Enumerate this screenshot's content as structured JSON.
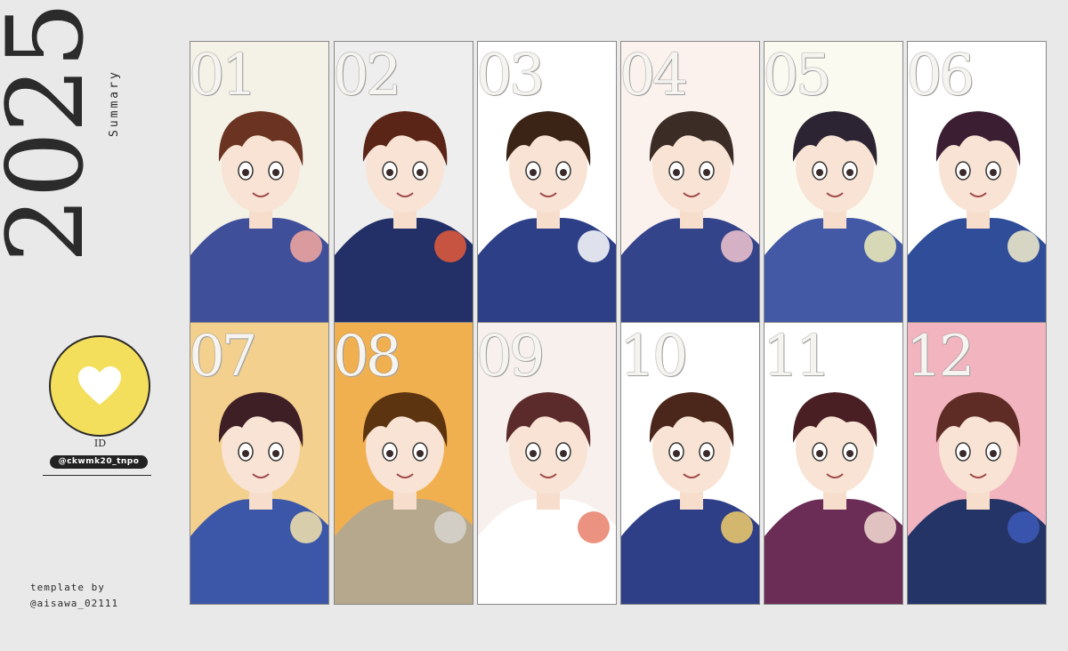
{
  "title": {
    "year": "2025",
    "subtitle": "Summary"
  },
  "profile": {
    "icon": "heart-icon",
    "accent": "#f3df5c",
    "id_label": "ID",
    "handle": "@ckwmk20_tnpo"
  },
  "credit": {
    "line1": "template by",
    "line2": "@aisawa_02111"
  },
  "months": [
    {
      "num": "01",
      "bg": "#f4f1e6",
      "hair": "#6b3322",
      "shirt": "#3f4f9a",
      "accent": "#f6a8a0"
    },
    {
      "num": "02",
      "bg": "#eeeeee",
      "hair": "#5a2416",
      "shirt": "#233067",
      "accent": "#e45b3a"
    },
    {
      "num": "03",
      "bg": "#ffffff",
      "hair": "#3b2316",
      "shirt": "#2d3f86",
      "accent": "#ffffff"
    },
    {
      "num": "04",
      "bg": "#fbf2ee",
      "hair": "#3c2c26",
      "shirt": "#34448a",
      "accent": "#f1c4cf"
    },
    {
      "num": "05",
      "bg": "#fbfaf0",
      "hair": "#2c2433",
      "shirt": "#4359a6",
      "accent": "#f0efb9"
    },
    {
      "num": "06",
      "bg": "#ffffff",
      "hair": "#3c1e33",
      "shirt": "#2f4d98",
      "accent": "#f5eecb"
    },
    {
      "num": "07",
      "bg": "#f3d08d",
      "hair": "#3d1f25",
      "shirt": "#3c56a8",
      "accent": "#f5e3ad"
    },
    {
      "num": "08",
      "bg": "#f1b050",
      "hair": "#5c3410",
      "shirt": "#b6a88c",
      "accent": "#d7d5cf"
    },
    {
      "num": "09",
      "bg": "#f7f0ec",
      "hair": "#5b2a2a",
      "shirt": "#ffffff",
      "accent": "#e87f6a"
    },
    {
      "num": "10",
      "bg": "#ffffff",
      "hair": "#4b261a",
      "shirt": "#2e3f88",
      "accent": "#f0cc6a"
    },
    {
      "num": "11",
      "bg": "#ffffff",
      "hair": "#4a1f24",
      "shirt": "#6b2d55",
      "accent": "#f5ded5"
    },
    {
      "num": "12",
      "bg": "#f2b5c0",
      "hair": "#5e2c24",
      "shirt": "#243466",
      "accent": "#3d5ab8"
    }
  ]
}
